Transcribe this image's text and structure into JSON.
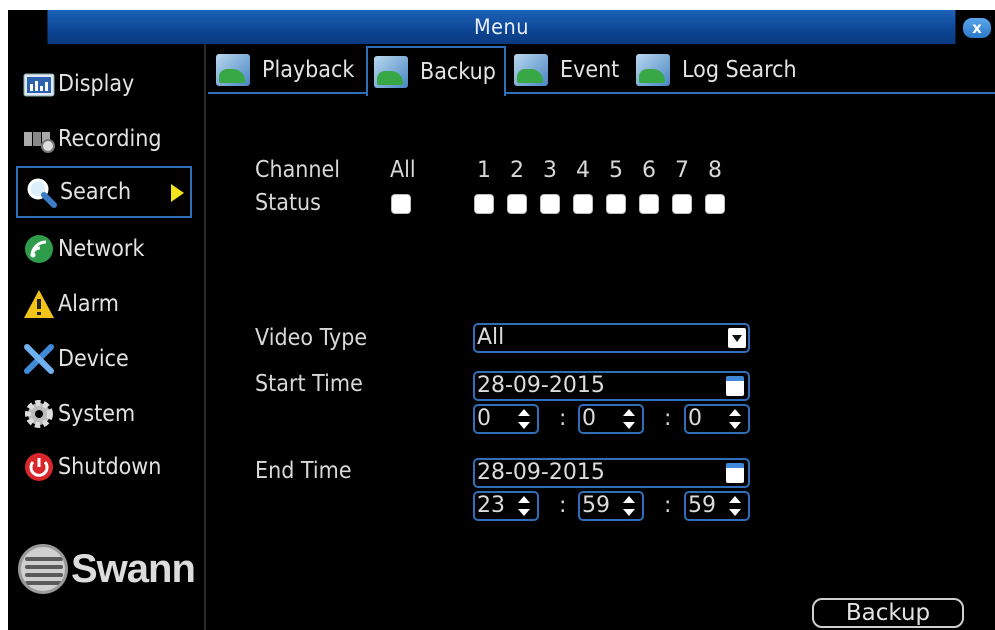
{
  "window": {
    "title": "Menu",
    "close_label": "x"
  },
  "sidebar": {
    "items": [
      {
        "label": "Display",
        "icon": "display-icon"
      },
      {
        "label": "Recording",
        "icon": "recording-icon"
      },
      {
        "label": "Search",
        "icon": "search-icon",
        "active": true
      },
      {
        "label": "Network",
        "icon": "network-icon"
      },
      {
        "label": "Alarm",
        "icon": "alarm-icon"
      },
      {
        "label": "Device",
        "icon": "device-icon"
      },
      {
        "label": "System",
        "icon": "gear-icon"
      },
      {
        "label": "Shutdown",
        "icon": "power-icon"
      }
    ],
    "logo_text": "Swann"
  },
  "tabs": [
    {
      "label": "Playback"
    },
    {
      "label": "Backup",
      "active": true
    },
    {
      "label": "Event"
    },
    {
      "label": "Log Search"
    }
  ],
  "channel": {
    "label": "Channel",
    "status_label": "Status",
    "all_label": "All",
    "numbers": [
      "1",
      "2",
      "3",
      "4",
      "5",
      "6",
      "7",
      "8"
    ]
  },
  "video_type": {
    "label": "Video Type",
    "value": "All"
  },
  "start_time": {
    "label": "Start Time",
    "date": "28-09-2015",
    "hour": "0",
    "minute": "0",
    "second": "0"
  },
  "end_time": {
    "label": "End Time",
    "date": "28-09-2015",
    "hour": "23",
    "minute": "59",
    "second": "59"
  },
  "actions": {
    "backup_label": "Backup"
  },
  "colors": {
    "accent": "#2f6fb7",
    "titlebar": "#0c4594",
    "active_arrow": "#f2e31c"
  }
}
